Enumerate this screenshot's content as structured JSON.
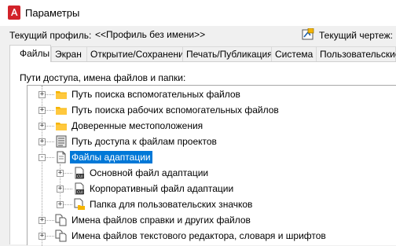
{
  "window": {
    "title": "Параметры"
  },
  "profile": {
    "current_profile_label": "Текущий профиль:",
    "current_profile_value": "<<Профиль без имени>>",
    "current_drawing_label": "Текущий чертеж:"
  },
  "tabs": [
    {
      "label": "Файлы",
      "active": true
    },
    {
      "label": "Экран"
    },
    {
      "label": "Открытие/Сохранение"
    },
    {
      "label": "Печать/Публикация"
    },
    {
      "label": "Система"
    },
    {
      "label": "Пользовательские"
    }
  ],
  "panel": {
    "paths_label": "Пути доступа, имена файлов и папки:"
  },
  "tree": {
    "items": [
      {
        "label": "Путь поиска вспомогательных файлов",
        "icon": "folder-icon",
        "expander": "+"
      },
      {
        "label": "Путь поиска рабочих вспомогательных файлов",
        "icon": "folder-icon",
        "expander": "+"
      },
      {
        "label": "Доверенные местоположения",
        "icon": "folder-icon",
        "expander": "+"
      },
      {
        "label": "Путь доступа к файлам проектов",
        "icon": "project-files-icon",
        "expander": "+"
      },
      {
        "label": "Файлы адаптации",
        "icon": "document-icon",
        "expander": "-",
        "selected": true
      },
      {
        "label": "Основной файл адаптации",
        "icon": "cui-file-icon",
        "expander": "+"
      },
      {
        "label": "Корпоративный файл адаптации",
        "icon": "cui-file-icon",
        "expander": "+"
      },
      {
        "label": "Папка для пользовательских значков",
        "icon": "document-folder-icon",
        "expander": "+"
      },
      {
        "label": "Имена файлов справки и других файлов",
        "icon": "multi-document-icon",
        "expander": "+"
      },
      {
        "label": "Имена файлов текстового редактора, словаря и шрифтов",
        "icon": "multi-document-icon",
        "expander": "+"
      }
    ]
  },
  "colors": {
    "selection": "#0078d7",
    "folder": "#f5b400",
    "app_icon": "#d2232a"
  }
}
